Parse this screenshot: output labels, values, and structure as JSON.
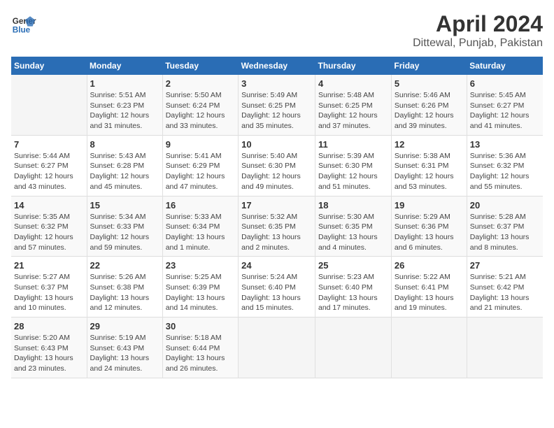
{
  "header": {
    "logo_line1": "General",
    "logo_line2": "Blue",
    "title": "April 2024",
    "subtitle": "Dittewal, Punjab, Pakistan"
  },
  "calendar": {
    "days_of_week": [
      "Sunday",
      "Monday",
      "Tuesday",
      "Wednesday",
      "Thursday",
      "Friday",
      "Saturday"
    ],
    "weeks": [
      [
        {
          "day": "",
          "content": ""
        },
        {
          "day": "1",
          "content": "Sunrise: 5:51 AM\nSunset: 6:23 PM\nDaylight: 12 hours\nand 31 minutes."
        },
        {
          "day": "2",
          "content": "Sunrise: 5:50 AM\nSunset: 6:24 PM\nDaylight: 12 hours\nand 33 minutes."
        },
        {
          "day": "3",
          "content": "Sunrise: 5:49 AM\nSunset: 6:25 PM\nDaylight: 12 hours\nand 35 minutes."
        },
        {
          "day": "4",
          "content": "Sunrise: 5:48 AM\nSunset: 6:25 PM\nDaylight: 12 hours\nand 37 minutes."
        },
        {
          "day": "5",
          "content": "Sunrise: 5:46 AM\nSunset: 6:26 PM\nDaylight: 12 hours\nand 39 minutes."
        },
        {
          "day": "6",
          "content": "Sunrise: 5:45 AM\nSunset: 6:27 PM\nDaylight: 12 hours\nand 41 minutes."
        }
      ],
      [
        {
          "day": "7",
          "content": "Sunrise: 5:44 AM\nSunset: 6:27 PM\nDaylight: 12 hours\nand 43 minutes."
        },
        {
          "day": "8",
          "content": "Sunrise: 5:43 AM\nSunset: 6:28 PM\nDaylight: 12 hours\nand 45 minutes."
        },
        {
          "day": "9",
          "content": "Sunrise: 5:41 AM\nSunset: 6:29 PM\nDaylight: 12 hours\nand 47 minutes."
        },
        {
          "day": "10",
          "content": "Sunrise: 5:40 AM\nSunset: 6:30 PM\nDaylight: 12 hours\nand 49 minutes."
        },
        {
          "day": "11",
          "content": "Sunrise: 5:39 AM\nSunset: 6:30 PM\nDaylight: 12 hours\nand 51 minutes."
        },
        {
          "day": "12",
          "content": "Sunrise: 5:38 AM\nSunset: 6:31 PM\nDaylight: 12 hours\nand 53 minutes."
        },
        {
          "day": "13",
          "content": "Sunrise: 5:36 AM\nSunset: 6:32 PM\nDaylight: 12 hours\nand 55 minutes."
        }
      ],
      [
        {
          "day": "14",
          "content": "Sunrise: 5:35 AM\nSunset: 6:32 PM\nDaylight: 12 hours\nand 57 minutes."
        },
        {
          "day": "15",
          "content": "Sunrise: 5:34 AM\nSunset: 6:33 PM\nDaylight: 12 hours\nand 59 minutes."
        },
        {
          "day": "16",
          "content": "Sunrise: 5:33 AM\nSunset: 6:34 PM\nDaylight: 13 hours\nand 1 minute."
        },
        {
          "day": "17",
          "content": "Sunrise: 5:32 AM\nSunset: 6:35 PM\nDaylight: 13 hours\nand 2 minutes."
        },
        {
          "day": "18",
          "content": "Sunrise: 5:30 AM\nSunset: 6:35 PM\nDaylight: 13 hours\nand 4 minutes."
        },
        {
          "day": "19",
          "content": "Sunrise: 5:29 AM\nSunset: 6:36 PM\nDaylight: 13 hours\nand 6 minutes."
        },
        {
          "day": "20",
          "content": "Sunrise: 5:28 AM\nSunset: 6:37 PM\nDaylight: 13 hours\nand 8 minutes."
        }
      ],
      [
        {
          "day": "21",
          "content": "Sunrise: 5:27 AM\nSunset: 6:37 PM\nDaylight: 13 hours\nand 10 minutes."
        },
        {
          "day": "22",
          "content": "Sunrise: 5:26 AM\nSunset: 6:38 PM\nDaylight: 13 hours\nand 12 minutes."
        },
        {
          "day": "23",
          "content": "Sunrise: 5:25 AM\nSunset: 6:39 PM\nDaylight: 13 hours\nand 14 minutes."
        },
        {
          "day": "24",
          "content": "Sunrise: 5:24 AM\nSunset: 6:40 PM\nDaylight: 13 hours\nand 15 minutes."
        },
        {
          "day": "25",
          "content": "Sunrise: 5:23 AM\nSunset: 6:40 PM\nDaylight: 13 hours\nand 17 minutes."
        },
        {
          "day": "26",
          "content": "Sunrise: 5:22 AM\nSunset: 6:41 PM\nDaylight: 13 hours\nand 19 minutes."
        },
        {
          "day": "27",
          "content": "Sunrise: 5:21 AM\nSunset: 6:42 PM\nDaylight: 13 hours\nand 21 minutes."
        }
      ],
      [
        {
          "day": "28",
          "content": "Sunrise: 5:20 AM\nSunset: 6:43 PM\nDaylight: 13 hours\nand 23 minutes."
        },
        {
          "day": "29",
          "content": "Sunrise: 5:19 AM\nSunset: 6:43 PM\nDaylight: 13 hours\nand 24 minutes."
        },
        {
          "day": "30",
          "content": "Sunrise: 5:18 AM\nSunset: 6:44 PM\nDaylight: 13 hours\nand 26 minutes."
        },
        {
          "day": "",
          "content": ""
        },
        {
          "day": "",
          "content": ""
        },
        {
          "day": "",
          "content": ""
        },
        {
          "day": "",
          "content": ""
        }
      ]
    ]
  }
}
